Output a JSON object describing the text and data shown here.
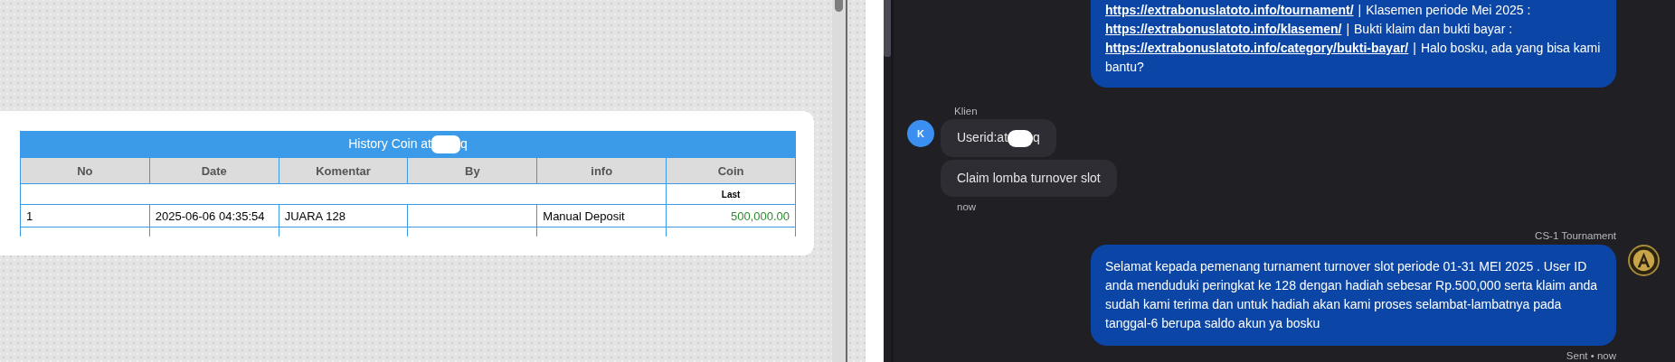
{
  "history_panel": {
    "title_before": "History Coin at",
    "title_redacted": true,
    "title_after": "q",
    "columns": [
      "No",
      "Date",
      "Komentar",
      "By",
      "info",
      "Coin"
    ],
    "subheader": "Last",
    "rows": [
      {
        "no": "1",
        "date": "2025-06-06 04:35:54",
        "komentar": "JUARA 128",
        "info": "Manual Deposit",
        "coin": "500,000.00"
      }
    ]
  },
  "chat": {
    "messages": [
      {
        "kind": "outgoing",
        "lines": [
          [
            {
              "kind": "link",
              "text": "https://extrabonuslatoto.info/tournament/"
            },
            {
              "kind": "bar",
              "text": "|"
            },
            {
              "kind": "text",
              "text": "Klasemen periode Mei 2025 :"
            }
          ],
          [
            {
              "kind": "link",
              "text": "https://extrabonuslatoto.info/klasemen/"
            },
            {
              "kind": "bar",
              "text": "|"
            },
            {
              "kind": "text",
              "text": "Bukti klaim dan bukti bayar :"
            }
          ],
          [
            {
              "kind": "link",
              "text": "https://extrabonuslatoto.info/category/bukti-bayar/"
            },
            {
              "kind": "bar",
              "text": "|"
            },
            {
              "kind": "text",
              "text": "Halo bosku, ada yang bisa kami"
            }
          ],
          [
            {
              "kind": "text",
              "text": "bantu?"
            }
          ]
        ]
      },
      {
        "kind": "incoming",
        "sender": "Klien",
        "avatar": "K",
        "bubbles": [
          {
            "before": "Userid:at",
            "redacted": true,
            "after": "q"
          },
          {
            "before": "Claim lomba turnover slot",
            "redacted": false
          }
        ],
        "time": "now"
      },
      {
        "kind": "outgoing",
        "sender": "CS-1 Tournament",
        "text": "Selamat kepada pemenang turnament turnover slot periode 01-31 MEI 2025 . User ID anda menduduki peringkat ke 128 dengan hadiah sebesar Rp.500,000 serta klaim anda sudah kami terima dan untuk hadiah akan kami proses selambat-lambatnya pada tanggal-6 berupa saldo akun ya bosku",
        "avatar": true,
        "status": "Sent • now"
      }
    ]
  }
}
